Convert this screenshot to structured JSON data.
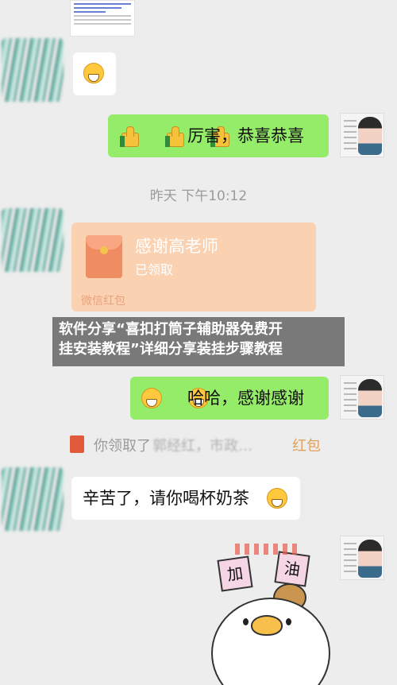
{
  "messages": {
    "m1_emoji": "grin-emoji",
    "m2_text": "厉害，恭喜恭喜",
    "timestamp": "昨天 下午10:12",
    "red_packet": {
      "title": "感谢高老师",
      "status": "已领取",
      "footer": "微信红包"
    },
    "m3_text": "哈哈，感谢感谢",
    "system_notice": {
      "prefix": "你领取了",
      "name": "郭经红，市政…",
      "suffix": "红包"
    },
    "m4_text": "辛苦了，请你喝杯奶茶",
    "sticker_text": {
      "left": "加",
      "right": "油"
    }
  },
  "banner": {
    "line1": "软件分享“喜扣打筒子辅助器免费开",
    "line2": "挂安装教程”详细分享装挂步骤教程"
  },
  "colors": {
    "background": "#ededed",
    "bubble_green": "#95ec69",
    "bubble_white": "#ffffff",
    "red_packet": "#fbd2b1"
  }
}
